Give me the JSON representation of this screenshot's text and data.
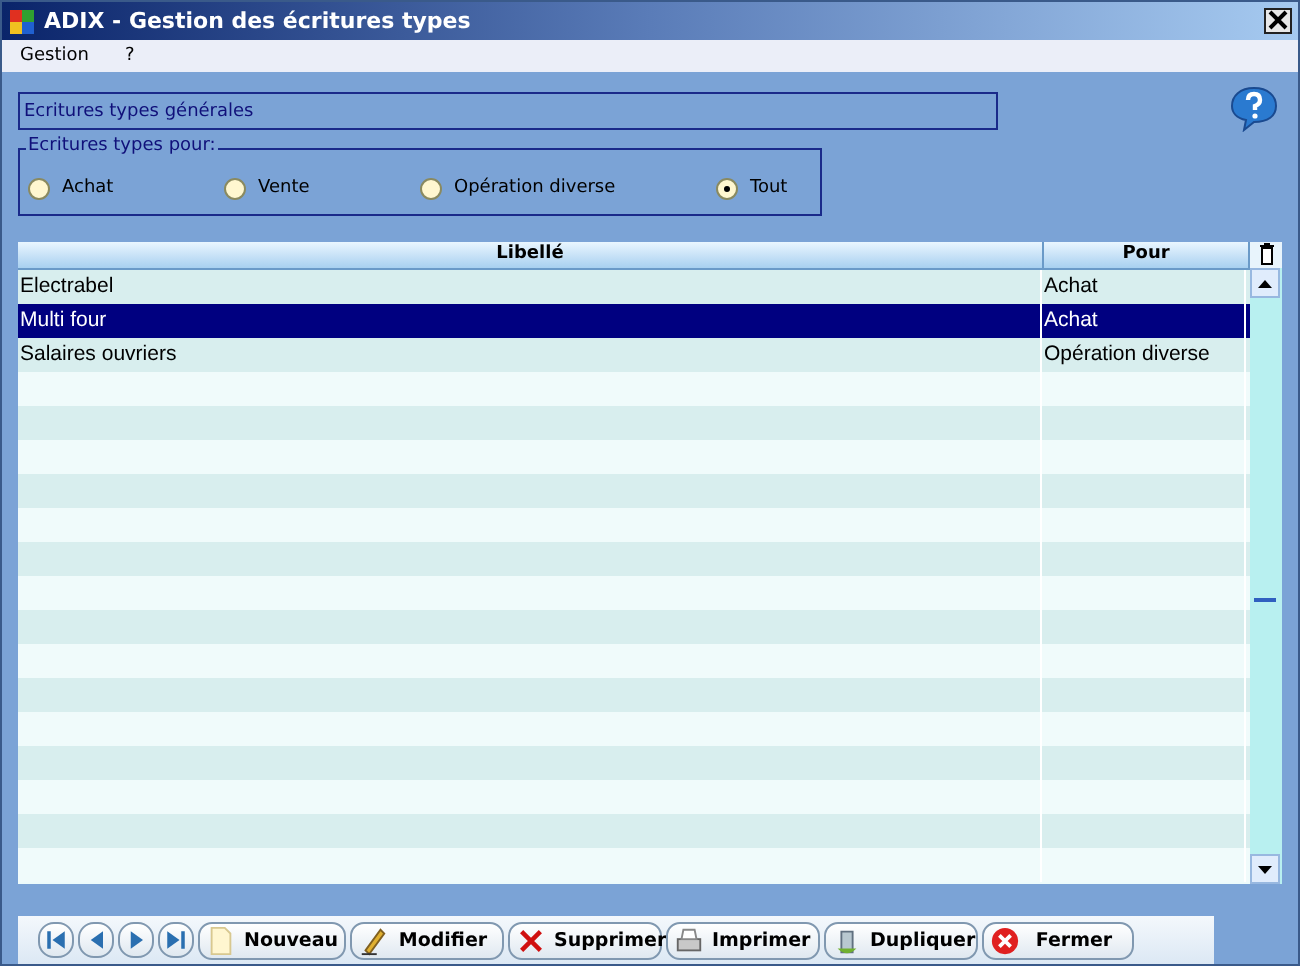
{
  "window": {
    "title": "ADIX - Gestion des écritures types"
  },
  "menu": [
    {
      "label": "Gestion"
    },
    {
      "label": "?"
    }
  ],
  "section_title": "Ecritures types générales",
  "filter": {
    "legend": "Ecritures types pour:",
    "options": [
      {
        "label": "Achat",
        "selected": false
      },
      {
        "label": "Vente",
        "selected": false
      },
      {
        "label": "Opération diverse",
        "selected": false
      },
      {
        "label": "Tout",
        "selected": true
      }
    ]
  },
  "table": {
    "columns": [
      "Libellé",
      "Pour"
    ],
    "rows": [
      {
        "cells": [
          "Electrabel",
          "Achat"
        ],
        "selected": false
      },
      {
        "cells": [
          "Multi four",
          "Achat"
        ],
        "selected": true
      },
      {
        "cells": [
          "Salaires ouvriers",
          "Opération diverse"
        ],
        "selected": false
      }
    ]
  },
  "toolbar": [
    {
      "kind": "first"
    },
    {
      "kind": "prev"
    },
    {
      "kind": "next"
    },
    {
      "kind": "last"
    },
    {
      "kind": "new",
      "label": "Nouveau"
    },
    {
      "kind": "edit",
      "label": "Modifier"
    },
    {
      "kind": "delete",
      "label": "Supprimer"
    },
    {
      "kind": "print",
      "label": "Imprimer"
    },
    {
      "kind": "copy",
      "label": "Dupliquer"
    },
    {
      "kind": "close",
      "label": "Fermer"
    }
  ]
}
